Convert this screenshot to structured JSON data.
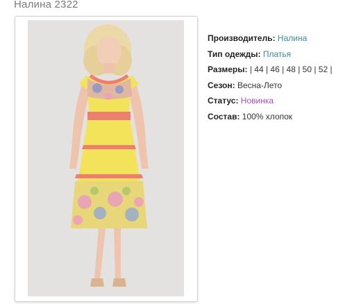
{
  "product": {
    "title": "Налина 2322",
    "image_alt": "Yellow floral summer dress with coral stripes"
  },
  "specs": {
    "manufacturer": {
      "label": "Производитель:",
      "value": "Налина"
    },
    "clothing_type": {
      "label": "Тип одежды:",
      "value": "Платья"
    },
    "sizes": {
      "label": "Размеры:",
      "value": "| 44 | 46 | 48 | 50 | 52 |"
    },
    "season": {
      "label": "Сезон:",
      "value": "Весна-Лето"
    },
    "status": {
      "label": "Статус:",
      "value": "Новинка"
    },
    "composition": {
      "label": "Состав:",
      "value": "100% хлопок"
    }
  },
  "colors": {
    "link_teal": "#3a8b8e",
    "link_purple": "#a64fb5",
    "dress_yellow": "#f3e35a",
    "dress_coral": "#ee7f6e"
  }
}
